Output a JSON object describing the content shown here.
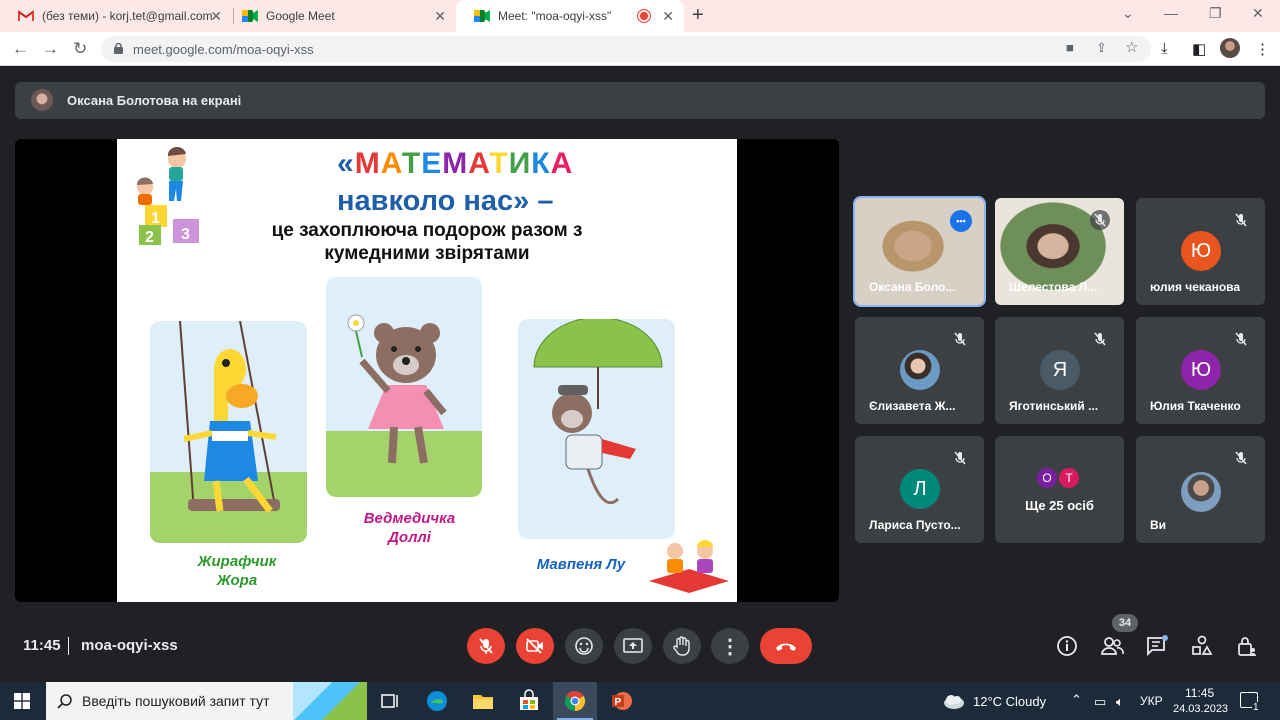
{
  "browser": {
    "tabs": [
      {
        "label": "(без теми) - korj.tet@gmail.com",
        "icon": "gmail-icon"
      },
      {
        "label": "Google Meet",
        "icon": "meet-icon"
      },
      {
        "label": "Meet: \"moa-oqyi-xss\"",
        "icon": "meet-icon",
        "active": true
      }
    ],
    "url": "meet.google.com/moa-oqyi-xss"
  },
  "presenting_banner": "Оксана Болотова на екрані",
  "slide": {
    "title_line1": "«МАТЕМАТИКА",
    "title_line2": "навколо нас» –",
    "subtitle_line1": "це захоплююча подорож разом з",
    "subtitle_line2": "кумедними звірятами",
    "title_colors": [
      "#e53935",
      "#fb8c00",
      "#43a047",
      "#1e88e5",
      "#8e24aa",
      "#e53935",
      "#fdd835",
      "#43a047",
      "#1e88e5",
      "#e91e63"
    ],
    "captions": [
      {
        "line1": "Жирафчик",
        "line2": "Жора",
        "color": "#2e9a2e"
      },
      {
        "line1": "Ведмедичка",
        "line2": "Доллі",
        "color": "#c2188b"
      },
      {
        "line1": "Мавпеня Лу",
        "line2": "",
        "color": "#1565c0"
      }
    ]
  },
  "participants": [
    {
      "name": "Оксана Боло...",
      "type": "video",
      "active_speaker": true
    },
    {
      "name": "Шелестова Л...",
      "type": "video",
      "muted": true
    },
    {
      "name": "юлия чеканова",
      "type": "letter",
      "letter": "Ю",
      "color": "#e8551e",
      "muted": true
    },
    {
      "name": "Єлизавета Ж...",
      "type": "photo",
      "muted": true
    },
    {
      "name": "Яготинський ...",
      "type": "letter",
      "letter": "Я",
      "color": "#4a5a66",
      "muted": true
    },
    {
      "name": "Юлия Ткаченко",
      "type": "letter",
      "letter": "Ю",
      "color": "#8e24aa",
      "muted": true
    },
    {
      "name": "Лариса Пусто...",
      "type": "letter",
      "letter": "Л",
      "color": "#00897b",
      "muted": true
    },
    {
      "name": "Ще 25 осіб",
      "type": "more",
      "letters": [
        "О",
        "Т"
      ],
      "colors": [
        "#7b1fa2",
        "#d81b60"
      ]
    },
    {
      "name": "Ви",
      "type": "photo",
      "muted": true
    }
  ],
  "meeting": {
    "time": "11:45",
    "code": "moa-oqyi-xss",
    "people_count": "34"
  },
  "taskbar": {
    "search_placeholder": "Введіть пошуковий запит тут",
    "weather": "12°C  Cloudy",
    "lang": "УКР",
    "clock_time": "11:45",
    "clock_date": "24.03.2023",
    "notification_count": "1"
  }
}
